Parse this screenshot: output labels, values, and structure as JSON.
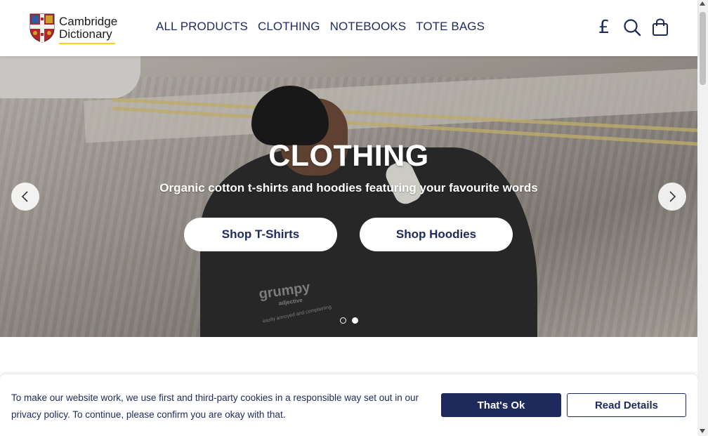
{
  "brand": {
    "line1": "Cambridge",
    "line2": "Dictionary",
    "shield_color": "#b5232a",
    "underline_color": "#f7d117"
  },
  "nav": {
    "items": [
      {
        "label": "ALL PRODUCTS"
      },
      {
        "label": "CLOTHING"
      },
      {
        "label": "NOTEBOOKS"
      },
      {
        "label": "TOTE BAGS"
      }
    ]
  },
  "header_icons": {
    "currency_symbol": "£",
    "currency_icon": "pound-icon",
    "search_icon": "search-icon",
    "cart_icon": "shopping-bag-icon"
  },
  "hero": {
    "title": "CLOTHING",
    "subtitle": "Organic cotton t-shirts and hoodies featuring your favourite words",
    "buttons": [
      {
        "label": "Shop T-Shirts"
      },
      {
        "label": "Shop Hoodies"
      }
    ],
    "slide_count": 2,
    "active_slide": 2,
    "image_text": {
      "word": "grumpy",
      "part_of_speech": "adjective",
      "definition": "easily annoyed and complaining"
    }
  },
  "cookie": {
    "message": "To make our website work, we use first and third-party cookies in a responsible way set out in our privacy policy. To continue, please confirm you are okay with that.",
    "accept_label": "That's Ok",
    "details_label": "Read Details"
  },
  "colors": {
    "primary": "#1d2a5b",
    "white": "#ffffff"
  }
}
